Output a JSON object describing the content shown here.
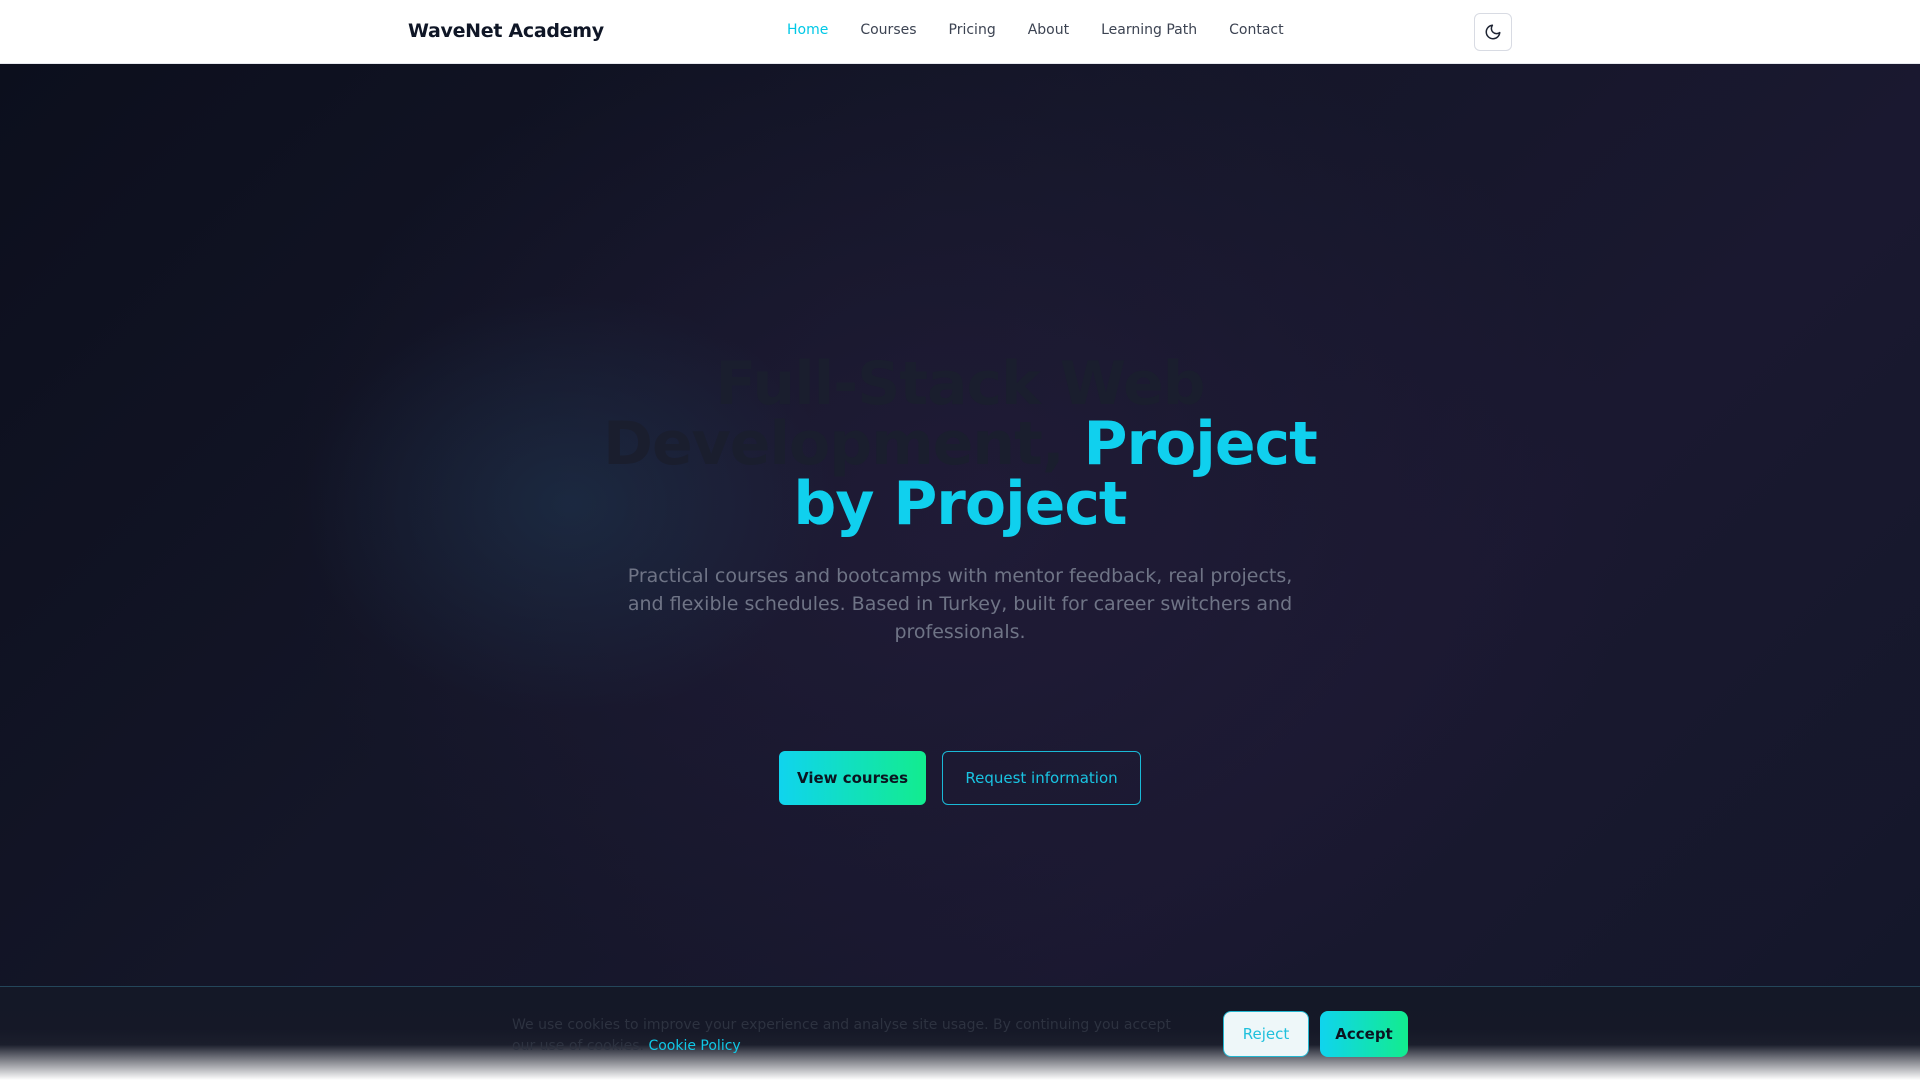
{
  "navbar": {
    "brand": "WaveNet Academy",
    "links": [
      {
        "label": "Home",
        "active": true
      },
      {
        "label": "Courses"
      },
      {
        "label": "Pricing"
      },
      {
        "label": "About"
      },
      {
        "label": "Learning Path"
      },
      {
        "label": "Contact"
      }
    ],
    "theme_toggle_icon": "moon-icon"
  },
  "hero": {
    "title_part1": "Full-Stack Web Development, ",
    "title_part2": "Project by Project",
    "subtitle": "Practical courses and bootcamps with mentor feedback, real projects, and flexible schedules. Based in Turkey, built for career switchers and professionals.",
    "primary_button": "View courses",
    "secondary_button": "Request information"
  },
  "cookie_banner": {
    "text": "We use cookies to improve your experience and analyse site usage. By continuing you accept our use of cookies. ",
    "link_label": "Cookie Policy",
    "reject_label": "Reject",
    "accept_label": "Accept"
  },
  "colors": {
    "accent": "#10d0ee",
    "accent_green": "#12ec8e",
    "hero_bg": "#141628"
  }
}
